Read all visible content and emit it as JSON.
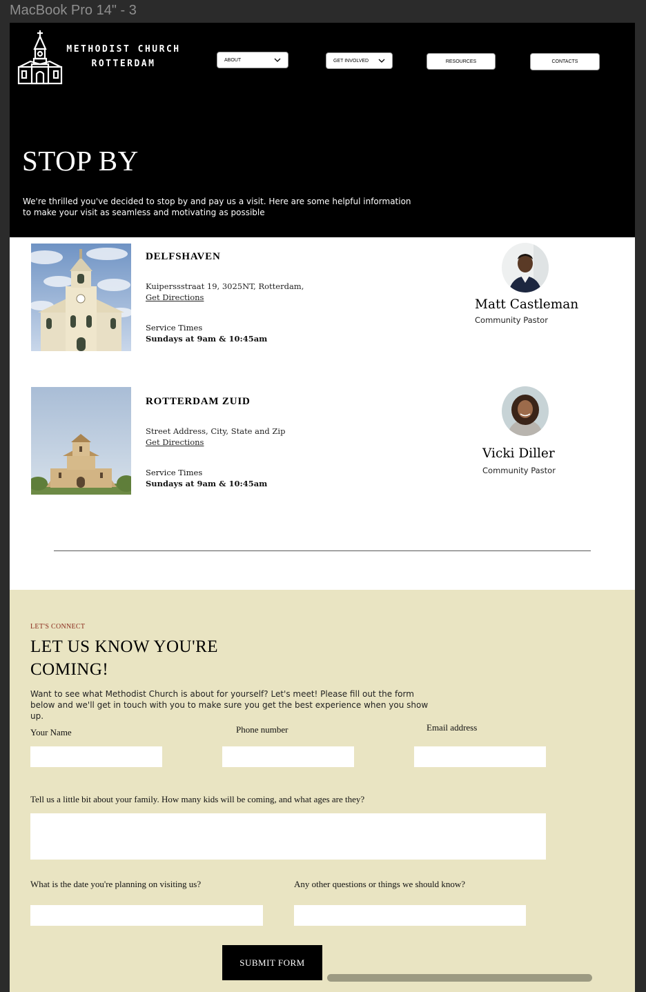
{
  "frame_label": "MacBook Pro 14\" - 3",
  "brand": {
    "line1": "METHODIST CHURCH",
    "line2": "ROTTERDAM"
  },
  "nav": {
    "about": "ABOUT",
    "get_involved": "GET INVOLVED",
    "resources": "RESOURCES",
    "contacts": "CONTACTS"
  },
  "hero": {
    "title": "STOP BY",
    "text": "We're thrilled you've decided to stop by and pay us a visit. Here are some helpful information to make your visit as seamless and motivating as possible"
  },
  "locations": [
    {
      "name": "DELFSHAVEN",
      "address": "Kuiperssstraat 19, 3025NT, Rotterdam,",
      "directions": "Get Directions",
      "service_label": "Service Times",
      "service_times": "Sundays at 9am & 10:45am",
      "pastor_name": "Matt Castleman",
      "pastor_role": "Community Pastor"
    },
    {
      "name": "ROTTERDAM ZUID",
      "address": "Street Address, City, State and Zip",
      "directions": "Get Directions",
      "service_label": "Service Times",
      "service_times": "Sundays at 9am & 10:45am",
      "pastor_name": "Vicki Diller",
      "pastor_role": "Community Pastor"
    }
  ],
  "connect": {
    "eyebrow": "LET'S CONNECT",
    "title": "LET US KNOW YOU'RE COMING!",
    "text": "Want to see what Methodist Church is about for yourself? Let's meet! Please fill out the form below and we'll get in touch with you to make sure you get the best experience when you show up.",
    "labels": {
      "name": "Your Name",
      "phone": "Phone number",
      "email": "Email address",
      "family": "Tell us a little bit about your family. How many kids will be coming, and what ages are they?",
      "date": "What is the date you're planning on visiting us?",
      "questions": "Any other questions or things we should know?"
    },
    "values": {
      "name": "",
      "phone": "",
      "email": "",
      "family": "",
      "date": "",
      "questions": ""
    },
    "submit": "SUBMIT FORM"
  },
  "colors": {
    "hero_bg": "#000000",
    "connect_bg": "#e9e4c2",
    "eyebrow": "#8a2a1c",
    "scrollbar": "#9c9a82"
  },
  "icons": [
    "church-logo-icon",
    "chevron-down-icon"
  ]
}
